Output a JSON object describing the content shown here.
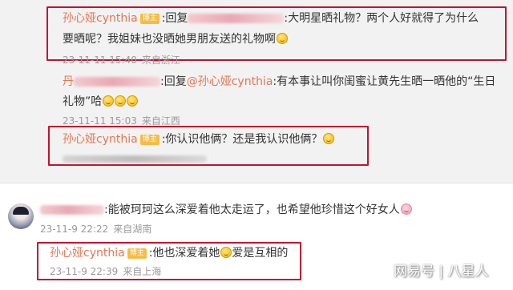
{
  "comments": {
    "c1": {
      "user": "孙心娅cynthia",
      "badge": "博主",
      "reply_prefix": ":回复",
      "text_line1": ":大明星晒礼物？两个人好就得了为什么",
      "text_line2": "要晒呢？我姐妹也没晒她男朋友送的礼物啊",
      "date": "23-11-11 15:40",
      "location": "来自浙江"
    },
    "c2": {
      "user_initial": "丹",
      "reply_text": ":回复",
      "mention": "@孙心娅cynthia",
      "text_line1": ":有本事让叫你闺蜜让黄先生晒一晒他的“生日",
      "text_line2": "礼物”哈",
      "date": "23-11-11 15:03",
      "location": "来自江西"
    },
    "c3": {
      "user": "孙心娅cynthia",
      "badge": "博主",
      "text": ":你认识他俩？还是我认识他俩？"
    },
    "c4": {
      "text": ":能被珂珂这么深爱着他太走运了，也希望他珍惜这个好女人",
      "date": "23-11-9 22:22",
      "location": "来自湖南"
    },
    "c5": {
      "user": "孙心娅cynthia",
      "badge": "博主",
      "text_a": ":他也深爱着她",
      "text_b": "爱是互相的",
      "date": "23-11-9 22:39",
      "location": "来自上海"
    }
  },
  "watermark": "网易号 | 八星人",
  "colors": {
    "username": "#eb7350",
    "badge": "#f6bc45",
    "highlight_box": "#c8102e",
    "meta": "#9a9a9a"
  },
  "icons": [
    "laugh-emoji",
    "pig-emoji",
    "user-avatar"
  ]
}
